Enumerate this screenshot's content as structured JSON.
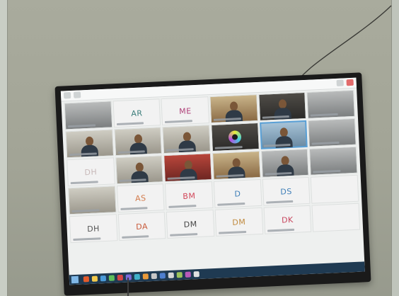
{
  "scene": {
    "wall_color": "#a2a496",
    "tv_frame_color": "#1a1a1a",
    "accent_outline": "#5aa0d6"
  },
  "meeting": {
    "tiles": [
      {
        "kind": "video",
        "tone": "gray",
        "person": false
      },
      {
        "kind": "initials",
        "text": "AR",
        "color": "#3b7d7a"
      },
      {
        "kind": "initials",
        "text": "ME",
        "color": "#b0427a"
      },
      {
        "kind": "video",
        "tone": "warm",
        "person": true
      },
      {
        "kind": "video",
        "tone": "dark",
        "person": true
      },
      {
        "kind": "video",
        "tone": "gray",
        "person": false
      },
      {
        "kind": "video",
        "tone": "room",
        "person": true
      },
      {
        "kind": "video",
        "tone": "room",
        "person": true
      },
      {
        "kind": "video",
        "tone": "room",
        "person": true
      },
      {
        "kind": "logo",
        "tone": "dark"
      },
      {
        "kind": "video",
        "tone": "blue",
        "person": true,
        "highlight": true
      },
      {
        "kind": "video",
        "tone": "gray",
        "person": false
      },
      {
        "kind": "initials",
        "text": "DH",
        "color": "#c8b9b9"
      },
      {
        "kind": "video",
        "tone": "room",
        "person": true
      },
      {
        "kind": "video",
        "tone": "red",
        "person": true
      },
      {
        "kind": "video",
        "tone": "warm",
        "person": true
      },
      {
        "kind": "video",
        "tone": "gray",
        "person": true
      },
      {
        "kind": "video",
        "tone": "gray",
        "person": false
      },
      {
        "kind": "video",
        "tone": "room",
        "person": false
      },
      {
        "kind": "initials",
        "text": "AS",
        "color": "#d27a4a"
      },
      {
        "kind": "initials",
        "text": "BM",
        "color": "#d2475a"
      },
      {
        "kind": "initials",
        "text": "D",
        "color": "#3f7fb8"
      },
      {
        "kind": "initials",
        "text": "DS",
        "color": "#3f7fb8"
      },
      {
        "kind": "empty"
      },
      {
        "kind": "initials",
        "text": "DH",
        "color": "#555555"
      },
      {
        "kind": "initials",
        "text": "DA",
        "color": "#c85a3a"
      },
      {
        "kind": "initials",
        "text": "DM",
        "color": "#444444"
      },
      {
        "kind": "initials",
        "text": "DM",
        "color": "#c08a3e"
      },
      {
        "kind": "initials",
        "text": "DK",
        "color": "#c8465e"
      },
      {
        "kind": "empty"
      }
    ]
  },
  "taskbar": {
    "icon_colors": [
      "#e35b2c",
      "#f2c94c",
      "#4b9bd9",
      "#5fbf5a",
      "#d64545",
      "#7c6ad8",
      "#3fb0c9",
      "#e89a3a",
      "#c7c7c7",
      "#4e7fcf",
      "#d6d6d6",
      "#9ac35b",
      "#b85ab8",
      "#e0e0e0"
    ]
  }
}
